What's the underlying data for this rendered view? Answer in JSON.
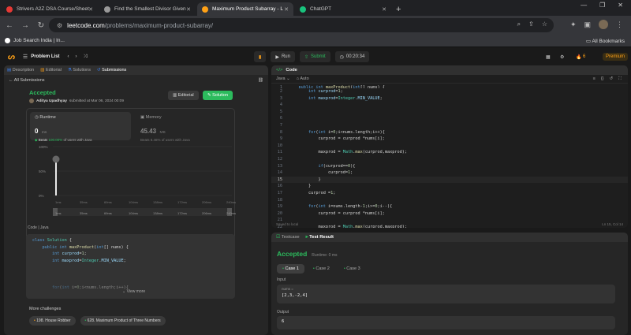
{
  "browser": {
    "tabs": [
      {
        "title": "Strivers A2Z DSA Course/Sheet",
        "color": "#e53935",
        "active": false
      },
      {
        "title": "Find the Smallest Divisor Given",
        "color": "#999999",
        "active": false
      },
      {
        "title": "Maximum Product Subarray - L",
        "color": "#ffa116",
        "active": true
      },
      {
        "title": "ChatGPT",
        "color": "#19c37d",
        "active": false
      }
    ],
    "new_tab": "+",
    "url_host": "leetcode.com",
    "url_path": "/problems/maximum-product-subarray/",
    "bookmark": "Job Search India | In...",
    "all_bookmarks": "All Bookmarks"
  },
  "lc": {
    "problem_list": "Problem List",
    "run": "Run",
    "submit": "Submit",
    "timer": "00:20:34",
    "streak": "6",
    "premium": "Premium",
    "left_tabs": [
      "Description",
      "Editorial",
      "Solutions",
      "Submissions"
    ],
    "all_submissions": "All Submissions",
    "status": "Accepted",
    "author": "Aditya Upadhyay",
    "submitted": "submitted at Mar 06, 2024 00:09",
    "editorial_btn": "Editorial",
    "solution_btn": "Solution",
    "runtime_label": "Runtime",
    "runtime_val": "0",
    "runtime_unit": "ms",
    "beats_label": "Beats",
    "beats_val": "100.00%",
    "beats_suffix": "of users with Java",
    "memory_label": "Memory",
    "memory_val": "45.43",
    "memory_unit": "MB",
    "memory_beats": "Beats 6.46% of users with Java",
    "y_ticks": [
      "100%",
      "50%",
      "0%"
    ],
    "x_ticks": [
      "1ms",
      "35ms",
      "69ms",
      "104ms",
      "138ms",
      "172ms",
      "206ms",
      "240ms"
    ],
    "code_label": "Code",
    "code_lang": "Java",
    "view_more": "View more",
    "more_challenges": "More challenges",
    "challenges": [
      "198. House Robber",
      "628. Maximum Product of Three Numbers"
    ],
    "editor_title": "Code",
    "editor_lang": "Java",
    "editor_auto": "Auto",
    "saved": "Saved to local",
    "cursor": "Ln 15, Col 14",
    "testcase_tab": "Testcase",
    "testresult_tab": "Test Result",
    "result_status": "Accepted",
    "result_runtime": "Runtime: 0 ms",
    "cases": [
      "Case 1",
      "Case 2",
      "Case 3"
    ],
    "input_label": "Input",
    "input_var": "nums =",
    "input_val": "[2,3,-2,4]",
    "output_label": "Output",
    "output_val": "6"
  }
}
